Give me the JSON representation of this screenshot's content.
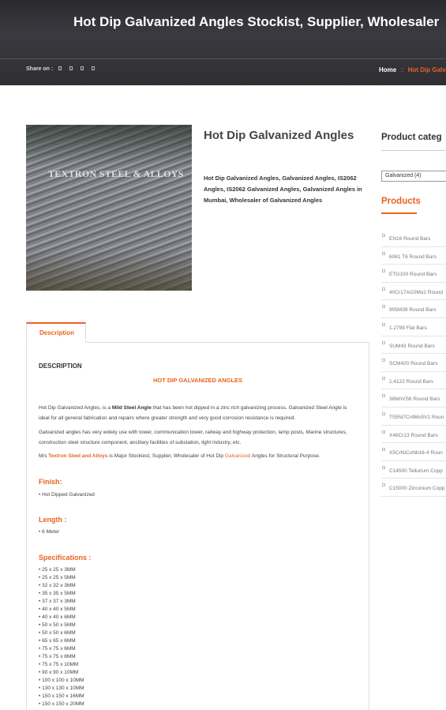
{
  "header": {
    "title": "Hot Dip Galvanized Angles Stockist, Supplier, Wholesaler",
    "share_label": "Share on :",
    "share_icons": [
      "facebook-icon",
      "twitter-icon",
      "linkedin-icon",
      "pinterest-icon"
    ],
    "breadcrumb": {
      "home": "Home",
      "separator": "::",
      "current": "Hot Dip Galv"
    }
  },
  "product": {
    "image_watermark": "TEXTRON STEEL & ALLOYS",
    "title": "Hot Dip Galvanized Angles",
    "tags": "Hot Dip Galvanized Angles, Galvanized Angles, IS2062 Angles, IS2062 Galvanized Angles, Galvanized Angles in Mumbai, Wholesaler of Galvanized Angles"
  },
  "sidebar": {
    "category_heading": "Product categ",
    "category_select": "Galvanized  (4)",
    "products_heading": "Products",
    "products": [
      "EN16 Round Bars",
      "6061 T6 Round Bars",
      "ETG100 Round Bars",
      "40Cr17Al10Mo2 Round",
      "905M39 Round Bars",
      "1.2799 Flat Bars",
      "SUM43 Round Bars",
      "SCM420 Round Bars",
      "1.4122 Round Bars",
      "38MnVS6 Round Bars",
      "T55Ni7Cr4Mo5V1 Roun",
      "X46Cr13 Round Bars",
      "X5CrNiCuNb16-4 Roun",
      "C14500 Tellurium Copp",
      "C15000 Zirconium Copp"
    ]
  },
  "tabs": {
    "description": "Description"
  },
  "description": {
    "heading": "DESCRIPTION",
    "subheading": "HOT DIP GALVANIZED ANGLES",
    "p1_a": "Hot Dip Galvanized Angles, is a ",
    "p1_b": "Mild Steel Angle",
    "p1_c": " that has been hot dipped in a zinc rich galvanizing process. Galvanized Steel Angle is ideal for all general fabrication and repairs where greater strength and very good corrosion resistance is required.",
    "p2": "Galvanized angles has very widely use with tower, communication tower, railway and highway protection, lamp posts, Marine structures, construction steel structure component, ancillary facilities of substation, light industry, etc.",
    "p3_a": "M/s ",
    "p3_b": "Textron Steel and Alloys",
    "p3_c": " is Major Stockiest, Supplier, Wholesaler of Hot Dip ",
    "p3_d": "Galvanized",
    "p3_e": " Angles for Structural Purpose.",
    "finish_heading": "Finish:",
    "finish_value": "•  Hot Dipped Galvanized",
    "length_heading": "Length :",
    "length_value": "•  6 Meter",
    "spec_heading": "Specifications :",
    "specs": [
      "25 x 25 x 3MM",
      "25 x 25 x 5MM",
      "32 x 32 x 3MM",
      "35 x 35 x 5MM",
      "37 x 37 x 3MM",
      "40 x 40 x 5MM",
      "40 x 40 x 6MM",
      "50 x 50 x 5MM",
      "50 x 50 x 6MM",
      "65 x 65 x 6MM",
      "75 x 75 x 6MM",
      "75 x 75 x 8MM",
      "75 x 75 x 10MM",
      "90 x 90 x 10MM",
      "100 x 100 x 10MM",
      "130 x 130 x 10MM",
      "150 x 150 x 16MM",
      "150 x 150 x 20MM"
    ]
  },
  "colors": {
    "accent": "#e8641f",
    "banner": "#2e2e33"
  }
}
